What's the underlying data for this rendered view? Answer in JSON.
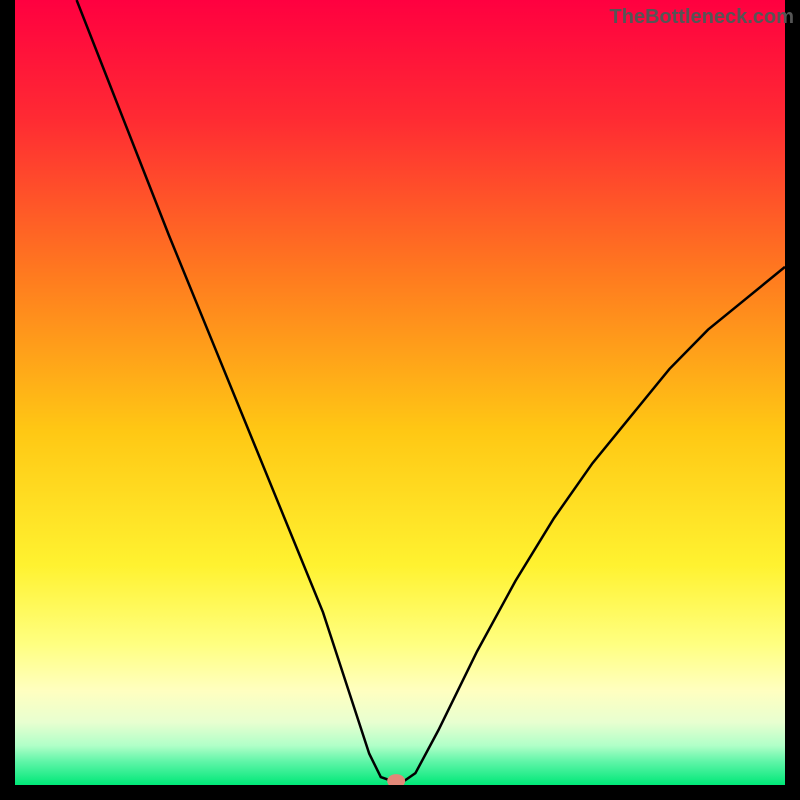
{
  "watermark": "TheBottleneck.com",
  "chart_data": {
    "type": "line",
    "title": "",
    "xlabel": "",
    "ylabel": "",
    "xlim": [
      0,
      100
    ],
    "ylim": [
      0,
      100
    ],
    "minimum_x": 49,
    "curve_points": [
      {
        "x": 8,
        "y": 100
      },
      {
        "x": 12,
        "y": 90
      },
      {
        "x": 16,
        "y": 80
      },
      {
        "x": 20,
        "y": 70
      },
      {
        "x": 25,
        "y": 58
      },
      {
        "x": 30,
        "y": 46
      },
      {
        "x": 35,
        "y": 34
      },
      {
        "x": 40,
        "y": 22
      },
      {
        "x": 44,
        "y": 10
      },
      {
        "x": 46,
        "y": 4
      },
      {
        "x": 47.5,
        "y": 1
      },
      {
        "x": 49,
        "y": 0.5
      },
      {
        "x": 50.5,
        "y": 0.5
      },
      {
        "x": 52,
        "y": 1.5
      },
      {
        "x": 55,
        "y": 7
      },
      {
        "x": 60,
        "y": 17
      },
      {
        "x": 65,
        "y": 26
      },
      {
        "x": 70,
        "y": 34
      },
      {
        "x": 75,
        "y": 41
      },
      {
        "x": 80,
        "y": 47
      },
      {
        "x": 85,
        "y": 53
      },
      {
        "x": 90,
        "y": 58
      },
      {
        "x": 95,
        "y": 62
      },
      {
        "x": 100,
        "y": 66
      }
    ],
    "marker": {
      "x": 49.5,
      "y": 0.5,
      "color": "#e28878"
    },
    "background_gradient": {
      "stops": [
        {
          "offset": 0,
          "color": "#ff0040"
        },
        {
          "offset": 15,
          "color": "#ff2a33"
        },
        {
          "offset": 35,
          "color": "#ff7a1f"
        },
        {
          "offset": 55,
          "color": "#ffc814"
        },
        {
          "offset": 72,
          "color": "#fff230"
        },
        {
          "offset": 82,
          "color": "#ffff80"
        },
        {
          "offset": 88,
          "color": "#ffffc0"
        },
        {
          "offset": 92,
          "color": "#e8ffd0"
        },
        {
          "offset": 95,
          "color": "#b0ffc8"
        },
        {
          "offset": 97,
          "color": "#60f5a8"
        },
        {
          "offset": 100,
          "color": "#00e878"
        }
      ]
    }
  }
}
